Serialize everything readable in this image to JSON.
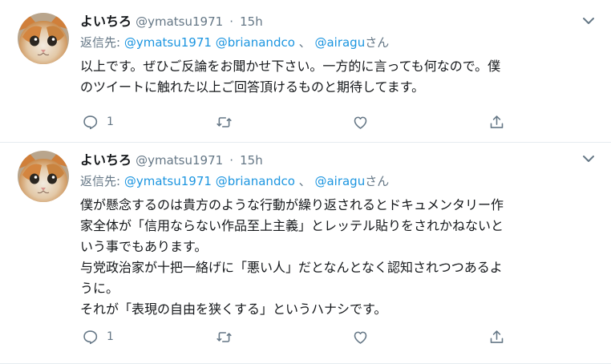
{
  "colors": {
    "link": "#1b95e0",
    "muted": "#657786",
    "text": "#14171a",
    "divider": "#e6ecf0"
  },
  "tweets": [
    {
      "name": "よいちろ",
      "handle": "@ymatsu1971",
      "dot": "·",
      "time": "15h",
      "reply_prefix": "返信先:",
      "reply_to": [
        "@ymatsu1971",
        "@brianandco",
        "、",
        "@airagu"
      ],
      "reply_suffix": "さん",
      "lines": [
        "以上です。ぜひご反論をお聞かせ下さい。一方的に言っても何なので。僕",
        "のツイートに触れた以上ご回答頂けるものと期待してます。"
      ],
      "reply_count": "1",
      "icons": [
        "reply-icon",
        "retweet-icon",
        "like-icon",
        "share-icon"
      ]
    },
    {
      "name": "よいちろ",
      "handle": "@ymatsu1971",
      "dot": "·",
      "time": "15h",
      "reply_prefix": "返信先:",
      "reply_to": [
        "@ymatsu1971",
        "@brianandco",
        "、",
        "@airagu"
      ],
      "reply_suffix": "さん",
      "lines": [
        "僕が懸念するのは貴方のような行動が繰り返されるとドキュメンタリー作",
        "家全体が「信用ならない作品至上主義」とレッテル貼りをされかねないと",
        "いう事でもあります。",
        "与党政治家が十把一絡げに「悪い人」だとなんとなく認知されつつあるよ",
        "うに。",
        "それが「表現の自由を狭くする」というハナシです。"
      ],
      "reply_count": "1",
      "icons": [
        "reply-icon",
        "retweet-icon",
        "like-icon",
        "share-icon"
      ]
    }
  ]
}
